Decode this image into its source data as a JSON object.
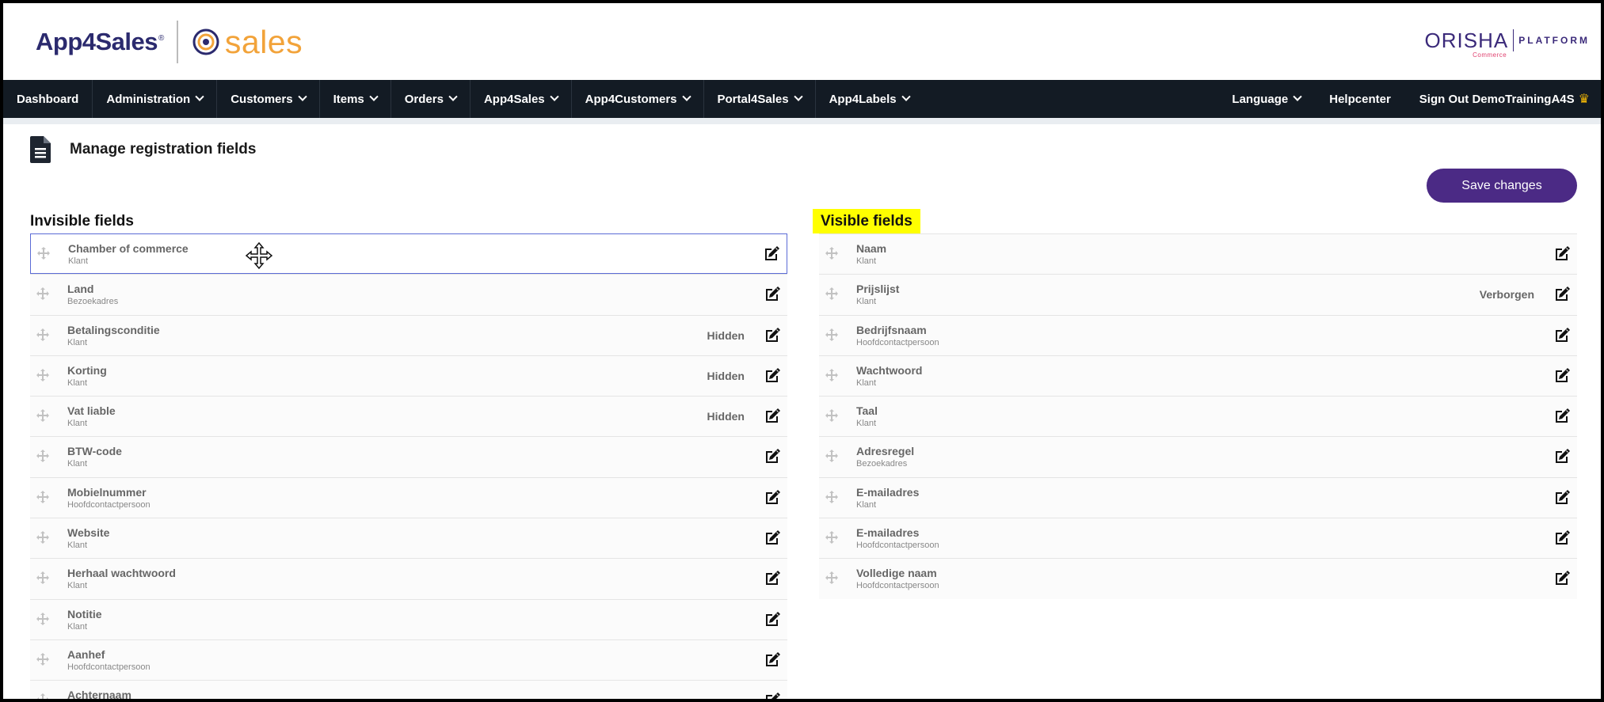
{
  "header": {
    "brand_name": "App4Sales",
    "brand_reg": "®",
    "product_name": "sales",
    "partner_name": "ORISHA",
    "partner_sub": "Commerce",
    "partner_platform": "PLATFORM"
  },
  "nav": {
    "items": [
      {
        "label": "Dashboard",
        "dropdown": false
      },
      {
        "label": "Administration",
        "dropdown": true
      },
      {
        "label": "Customers",
        "dropdown": true
      },
      {
        "label": "Items",
        "dropdown": true
      },
      {
        "label": "Orders",
        "dropdown": true
      },
      {
        "label": "App4Sales",
        "dropdown": true
      },
      {
        "label": "App4Customers",
        "dropdown": true
      },
      {
        "label": "Portal4Sales",
        "dropdown": true
      },
      {
        "label": "App4Labels",
        "dropdown": true
      }
    ],
    "language": "Language",
    "helpcenter": "Helpcenter",
    "signout_prefix": "Sign Out",
    "username": "DemoTrainingA4S",
    "crown": "♛"
  },
  "page": {
    "title": "Manage registration fields",
    "save_label": "Save changes"
  },
  "invisible": {
    "heading": "Invisible fields",
    "fields": [
      {
        "name": "Chamber of commerce",
        "source": "Klant",
        "status": ""
      },
      {
        "name": "Land",
        "source": "Bezoekadres",
        "status": ""
      },
      {
        "name": "Betalingsconditie",
        "source": "Klant",
        "status": "Hidden"
      },
      {
        "name": "Korting",
        "source": "Klant",
        "status": "Hidden"
      },
      {
        "name": "Vat liable",
        "source": "Klant",
        "status": "Hidden"
      },
      {
        "name": "BTW-code",
        "source": "Klant",
        "status": ""
      },
      {
        "name": "Mobielnummer",
        "source": "Hoofdcontactpersoon",
        "status": ""
      },
      {
        "name": "Website",
        "source": "Klant",
        "status": ""
      },
      {
        "name": "Herhaal wachtwoord",
        "source": "Klant",
        "status": ""
      },
      {
        "name": "Notitie",
        "source": "Klant",
        "status": ""
      },
      {
        "name": "Aanhef",
        "source": "Hoofdcontactpersoon",
        "status": ""
      },
      {
        "name": "Achternaam",
        "source": "",
        "status": ""
      }
    ]
  },
  "visible": {
    "heading": "Visible fields",
    "fields": [
      {
        "name": "Naam",
        "source": "Klant",
        "status": ""
      },
      {
        "name": "Prijslijst",
        "source": "Klant",
        "status": "Verborgen"
      },
      {
        "name": "Bedrijfsnaam",
        "source": "Hoofdcontactpersoon",
        "status": ""
      },
      {
        "name": "Wachtwoord",
        "source": "Klant",
        "status": ""
      },
      {
        "name": "Taal",
        "source": "Klant",
        "status": ""
      },
      {
        "name": "Adresregel",
        "source": "Bezoekadres",
        "status": ""
      },
      {
        "name": "E-mailadres",
        "source": "Klant",
        "status": ""
      },
      {
        "name": "E-mailadres",
        "source": "Hoofdcontactpersoon",
        "status": ""
      },
      {
        "name": "Volledige naam",
        "source": "Hoofdcontactpersoon",
        "status": ""
      }
    ]
  },
  "colors": {
    "nav_bg": "#131b24",
    "accent": "#4b2a85",
    "brand_orange": "#f2a33a",
    "highlight": "#ffff00"
  }
}
